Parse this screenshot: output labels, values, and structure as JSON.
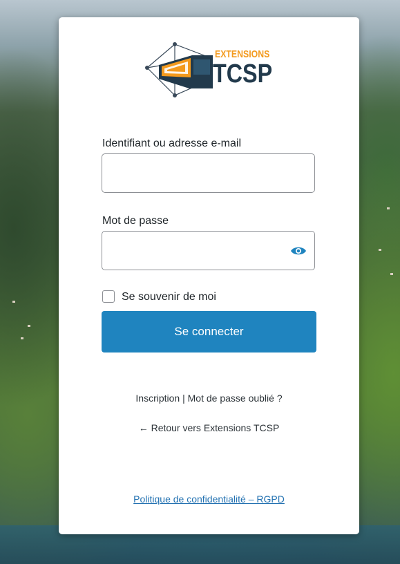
{
  "colors": {
    "primary": "#1f84bf",
    "link": "#2271b1",
    "logo_orange": "#f39a1e",
    "logo_dark": "#223a4c"
  },
  "logo": {
    "line1": "EXTENSIONS",
    "line2": "TCSP",
    "icon": "bus-network-logo-icon"
  },
  "form": {
    "username_label": "Identifiant ou adresse e-mail",
    "username_value": "",
    "password_label": "Mot de passe",
    "password_value": "",
    "show_password_icon": "eye-icon",
    "remember_label": "Se souvenir de moi",
    "remember_checked": false,
    "submit_label": "Se connecter"
  },
  "nav": {
    "register": "Inscription",
    "separator": "|",
    "lost_password": "Mot de passe oublié ?",
    "back_link": "← Retour vers Extensions TCSP"
  },
  "footer": {
    "privacy": "Politique de confidentialité – RGPD"
  }
}
